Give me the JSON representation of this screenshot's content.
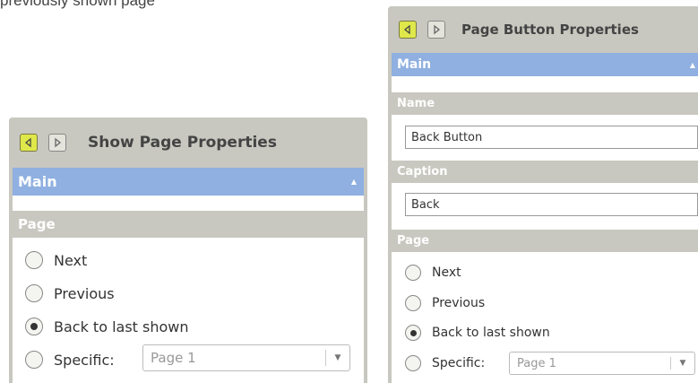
{
  "fragment_text": "previously shown page",
  "left_panel": {
    "title": "Show Page Properties",
    "main_label": "Main",
    "section_page": "Page",
    "options": [
      "Next",
      "Previous",
      "Back to last shown",
      "Specific:"
    ],
    "selected_option": "Back to last shown",
    "specific_value": "Page 1"
  },
  "right_panel": {
    "title": "Page Button Properties",
    "main_label": "Main",
    "section_name": "Name",
    "name_value": "Back Button",
    "section_caption": "Caption",
    "caption_value": "Back",
    "section_page": "Page",
    "options": [
      "Next",
      "Previous",
      "Back to last shown",
      "Specific:"
    ],
    "selected_option": "Back to last shown",
    "specific_value": "Page 1"
  },
  "colors": {
    "titlebar": "#c8c8c0",
    "main_header": "#8fb0e0",
    "active_nav": "#dfe84a"
  },
  "icons": [
    "back-arrow-icon",
    "forward-arrow-icon",
    "collapse-up-icon",
    "dropdown-arrow-icon"
  ]
}
